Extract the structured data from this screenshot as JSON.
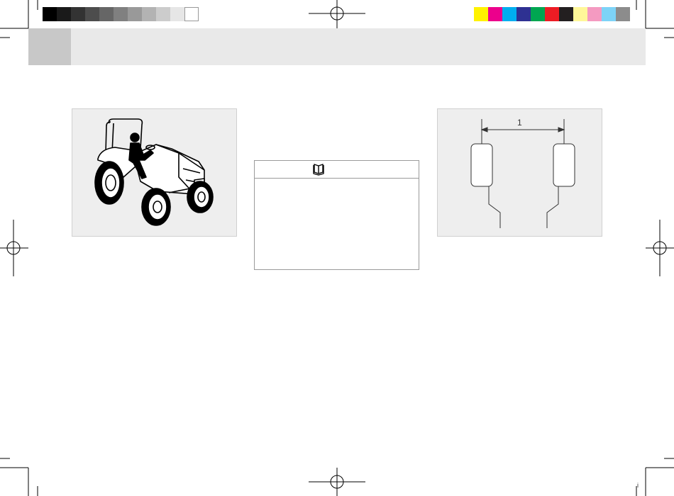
{
  "print_marks": {
    "grayscale_swatches": [
      "#000000",
      "#1a1a1a",
      "#333333",
      "#4d4d4d",
      "#666666",
      "#808080",
      "#999999",
      "#b3b3b3",
      "#cccccc",
      "#e6e6e6",
      "#ffffff"
    ],
    "color_swatches": [
      "#fff200",
      "#ec008c",
      "#00aeef",
      "#2e3192",
      "#00a651",
      "#ed1c24",
      "#231f20",
      "#fff799",
      "#f49ac1",
      "#7dd3f7",
      "#8c8c8c"
    ]
  },
  "figures": {
    "tractor": {
      "icon": "tractor-with-operator-illustration"
    },
    "note": {
      "icon": "open-book-icon"
    },
    "wheel_track": {
      "dimension_label": "1",
      "icon": "wheel-track-width-diagram"
    }
  },
  "footer": {
    "corner_mark": "i"
  }
}
